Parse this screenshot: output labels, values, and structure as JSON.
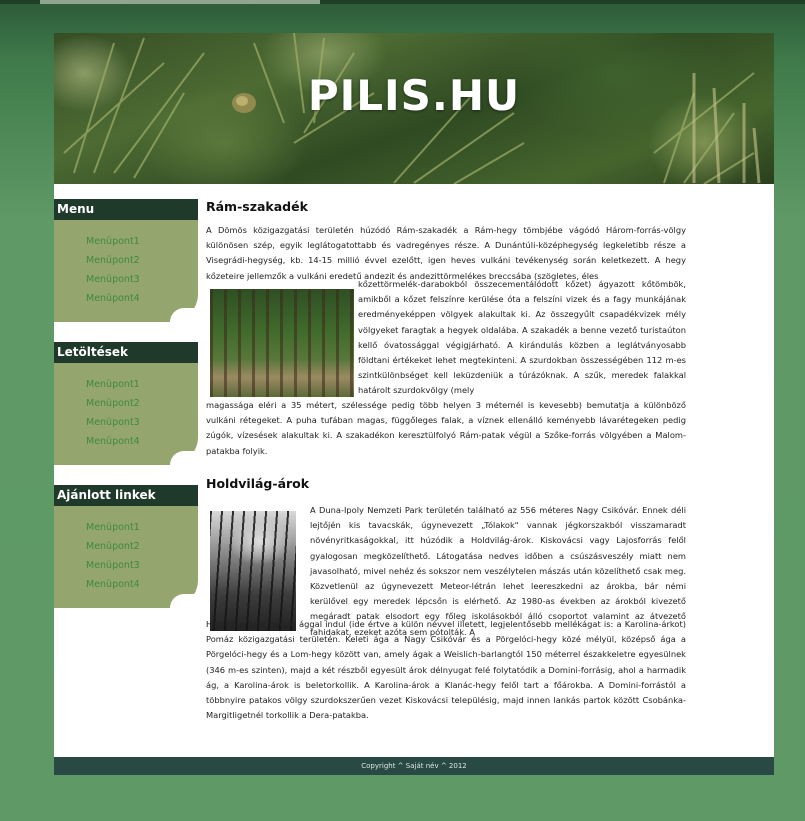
{
  "site": {
    "title": "PILIS.HU"
  },
  "sidebar": {
    "blocks": [
      {
        "title": "Menu",
        "items": [
          "Menüpont1",
          "Menüpont2",
          "Menüpont3",
          "Menüpont4"
        ]
      },
      {
        "title": "Letöltések",
        "items": [
          "Menüpont1",
          "Menüpont2",
          "Menüpont3",
          "Menüpont4"
        ]
      },
      {
        "title": "Ajánlott linkek",
        "items": [
          "Menüpont1",
          "Menüpont2",
          "Menüpont3",
          "Menüpont4"
        ]
      }
    ]
  },
  "content": {
    "sections": [
      {
        "title": "Rám-szakadék",
        "paragraph_top": "A Dömös közigazgatási területén húzódó Rám-szakadék a Rám-hegy tömbjébe vágódó Három-forrás-völgy különösen szép, egyik leglátogatottabb és vadregényes része. A Dunántúli-középhegység legkeletibb része a Visegrádi-hegység, kb. 14-15 millió évvel ezelőtt, igen heves vulkáni tevékenység során keletkezett. A hegy kőzeteire jellemzők a vulkáni eredetű andezit és andezittörmelékes breccsába (szögletes, éles",
        "paragraph_right": "kőzettörmelék-darabokból összecementálódott kőzet) ágyazott kőtömbök, amikből a kőzet felszínre kerülése óta a felszíni vizek és a fagy munkájának eredményeképpen völgyek alakultak ki. Az összegyűlt csapadékvizek mély völgyeket faragtak a hegyek oldalába. A szakadék a benne vezető turistaúton kellő óvatossággal végigjárható. A kirándulás közben a leglátványosabb földtani értékeket lehet megtekinteni. A szurdokban összességében 112 m-es szintkülönbséget kell leküzdeniük a túrázóknak. A szűk, meredek falakkal határolt szurdokvölgy (mely",
        "paragraph_bottom": "magassága eléri a 35 métert, szélessége pedig több helyen 3 méternél is kevesebb) bemutatja a különböző vulkáni rétegeket. A puha tufában magas, függőleges falak, a víznek ellenálló keményebb lávarétegeken pedig zúgók, vízesések alakultak ki. A szakadékon keresztülfolyó Rám-patak végül a Szőke-forrás völgyében a Malom-patakba folyik."
      },
      {
        "title": "Holdvilág-árok",
        "paragraph_right": "A Duna-Ipoly Nemzeti Park területén található az 556 méteres Nagy Csikóvár. Ennek déli lejtőjén kis tavacskák, úgynevezett „Tólakok\" vannak jégkorszakból visszamaradt növényritkaságokkal, itt húzódik a Holdvilág-árok. Kiskovácsi vagy Lajosforrás felől gyalogosan megközelíthető. Látogatása nedves időben a csúszásveszély miatt nem javasolható, mivel nehéz és sokszor nem veszélytelen mászás után közelíthető csak meg. Közvetlenül az úgynevezett Meteor-létrán lehet leereszkedni az árokba, bár némi kerülővel egy meredek lépcsőn is elérhető. Az 1980-as években az árokból kivezető megáradt patak elsodort egy főleg iskolásokból álló csoportot valamint az átvezető fahidakat, ezeket azóta sem pótolták. A",
        "paragraph_bottom": "Holdvilág-árok három ággal indul (ide értve a külön névvel illetett, legjelentősebb mellékágat is: a Karolina-árkot) Pomáz közigazgatási területén. Keleti ága a Nagy Csikóvár és a Pörgelóci-hegy közé mélyül, középső ága a Pörgelóci-hegy és a Lom-hegy között van, amely ágak a Weislich-barlangtól 150 méterrel északkeletre egyesülnek (346 m-es szinten), majd a két részből egyesült árok délnyugat felé folytatódik a Domini-forrásig, ahol a harmadik ág, a Karolina-árok is beletorkollik. A Karolina-árok a Klanác-hegy felől tart a főárokba. A Domini-forrástól a többnyire patakos völgy szurdokszerűen vezet Kiskovácsi településig, majd innen lankás partok között Csobánka-Margitligetnél torkollik a Dera-patakba."
      }
    ]
  },
  "footer": {
    "text": "Copyright ^ Saját név ^ 2012"
  }
}
